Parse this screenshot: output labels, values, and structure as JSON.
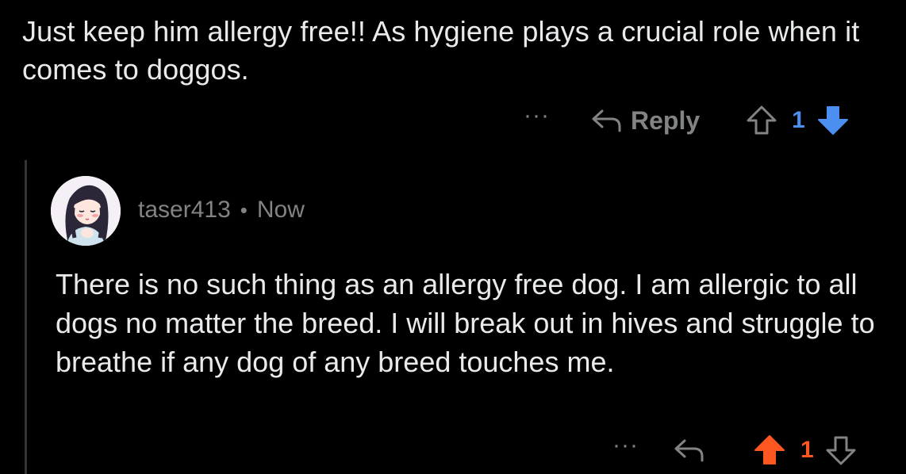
{
  "colors": {
    "background": "#000000",
    "text": "#e8eaec",
    "muted": "#818384",
    "upvote_orange": "#ff5722",
    "downvote_blue": "#4b8ff0",
    "thread_line": "#343536"
  },
  "parent_comment": {
    "body": "Just keep him allergy free!! As hygiene plays a crucial role when it comes to doggos.",
    "actions": {
      "more_label": "···",
      "reply_label": "Reply",
      "reply_icon": "reply-arrow-icon",
      "upvote_icon": "upvote-outline-icon",
      "score": "1",
      "downvote_icon": "downvote-filled-blue-icon",
      "vote_state": "downvoted"
    }
  },
  "child_comment": {
    "avatar_icon": "anime-girl-avatar",
    "username": "taser413",
    "separator": "•",
    "timestamp": "Now",
    "body": "There is no such thing as an allergy free dog. I am allergic to all dogs no matter the breed. I will break out in hives and struggle to breathe if any dog of any breed touches me.",
    "actions": {
      "more_label": "···",
      "reply_icon": "reply-arrow-icon",
      "upvote_icon": "upvote-filled-orange-icon",
      "score": "1",
      "downvote_icon": "downvote-outline-icon",
      "vote_state": "upvoted"
    }
  }
}
